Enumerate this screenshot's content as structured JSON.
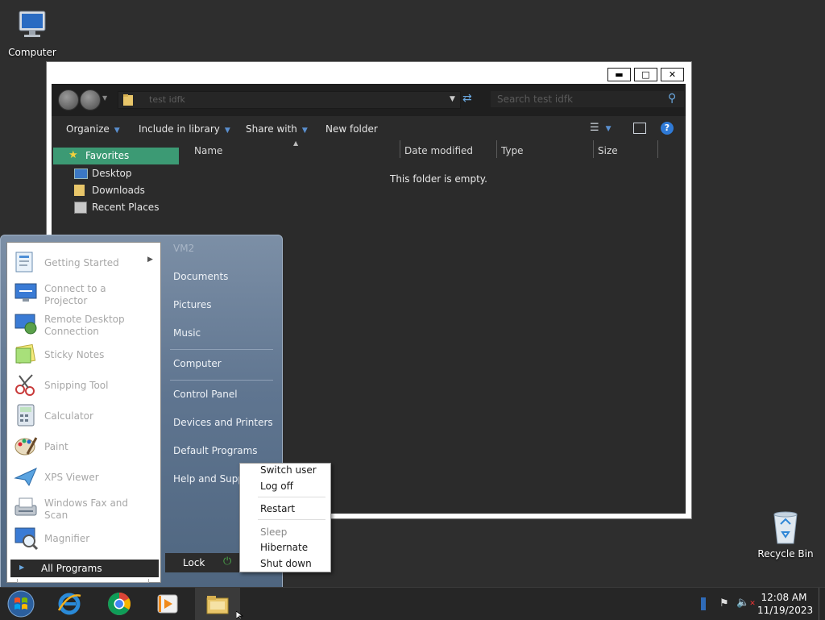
{
  "desktop": {
    "icons": [
      {
        "label": "Computer",
        "icon": "computer-icon"
      },
      {
        "label": "Recycle Bin",
        "icon": "recycle-bin-icon"
      }
    ]
  },
  "explorer": {
    "address": "test idfk",
    "search_placeholder": "Search test idfk",
    "toolbar": {
      "organize": "Organize",
      "include_in_library": "Include in library",
      "share_with": "Share with",
      "new_folder": "New folder"
    },
    "navpane": {
      "favorites": "Favorites",
      "items": [
        "Desktop",
        "Downloads",
        "Recent Places"
      ]
    },
    "columns": [
      "Name",
      "Date modified",
      "Type",
      "Size"
    ],
    "empty_message": "This folder is empty."
  },
  "start_menu": {
    "programs": [
      {
        "label": "Getting Started",
        "icon": "getting-started-icon",
        "has_submenu": true
      },
      {
        "label": "Connect to a Projector",
        "icon": "projector-icon"
      },
      {
        "label": "Remote Desktop Connection",
        "icon": "remote-desktop-icon"
      },
      {
        "label": "Sticky Notes",
        "icon": "sticky-notes-icon"
      },
      {
        "label": "Snipping Tool",
        "icon": "snipping-tool-icon"
      },
      {
        "label": "Calculator",
        "icon": "calculator-icon"
      },
      {
        "label": "Paint",
        "icon": "paint-icon"
      },
      {
        "label": "XPS Viewer",
        "icon": "xps-viewer-icon"
      },
      {
        "label": "Windows Fax and Scan",
        "icon": "fax-scan-icon"
      },
      {
        "label": "Magnifier",
        "icon": "magnifier-icon"
      }
    ],
    "all_programs": "All Programs",
    "right_links": [
      "VM2",
      "Documents",
      "Pictures",
      "Music",
      "Computer",
      "Control Panel",
      "Devices and Printers",
      "Default Programs",
      "Help and Support"
    ],
    "lock": "Lock",
    "power_menu": [
      "Switch user",
      "Log off",
      "Restart",
      "Sleep",
      "Hibernate",
      "Shut down"
    ]
  },
  "taskbar": {
    "pinned": [
      "start-orb-icon",
      "internet-explorer-icon",
      "chrome-icon",
      "media-player-icon",
      "file-explorer-icon"
    ],
    "clock_time": "12:08 AM",
    "clock_date": "11/19/2023"
  },
  "colors": {
    "accent_selected": "#3c9a74",
    "start_menu_blue": "#6a7f99",
    "explorer_bg": "#2b2b2b"
  }
}
